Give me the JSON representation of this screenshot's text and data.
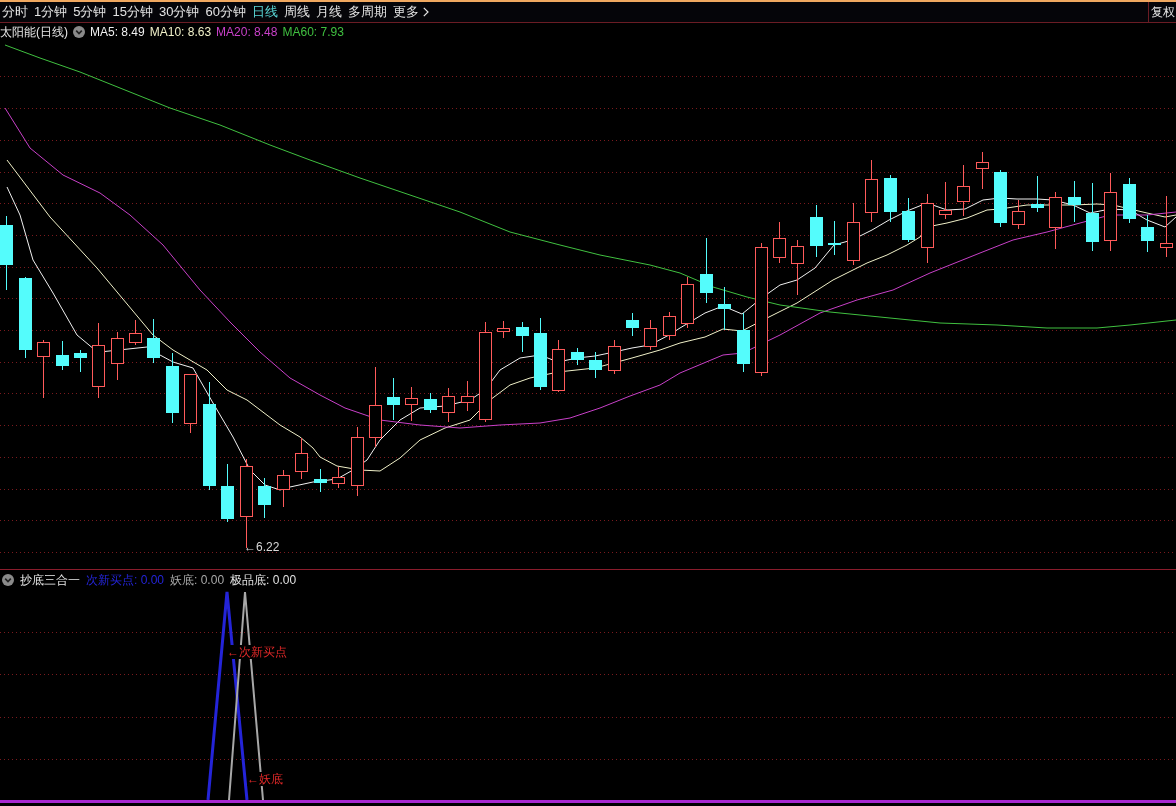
{
  "toolbar": {
    "tabs": [
      {
        "label": "分时",
        "selected": false,
        "kind": "period"
      },
      {
        "label": "1分钟",
        "selected": false,
        "kind": "period"
      },
      {
        "label": "5分钟",
        "selected": false,
        "kind": "period"
      },
      {
        "label": "15分钟",
        "selected": false,
        "kind": "period"
      },
      {
        "label": "30分钟",
        "selected": false,
        "kind": "period"
      },
      {
        "label": "60分钟",
        "selected": false,
        "kind": "period"
      },
      {
        "label": "日线",
        "selected": true,
        "kind": "period"
      },
      {
        "label": "周线",
        "selected": false,
        "kind": "period"
      },
      {
        "label": "月线",
        "selected": false,
        "kind": "period"
      },
      {
        "label": "多周期",
        "selected": false,
        "kind": "period"
      },
      {
        "label": "更多",
        "selected": false,
        "kind": "menu"
      }
    ],
    "adjust_button": "复权"
  },
  "price_chart": {
    "title": "太阳能(日线)",
    "moving_averages": [
      {
        "label": "MA5: 8.49",
        "color": "#f0f0f0"
      },
      {
        "label": "MA10: 8.63",
        "color": "#f0f0c8"
      },
      {
        "label": "MA20: 8.48",
        "color": "#c840c8"
      },
      {
        "label": "MA60: 7.93",
        "color": "#40c040"
      }
    ],
    "low_marker": "←6.22"
  },
  "indicator": {
    "title": "抄底三合一",
    "signals": [
      {
        "label": "次新买点: 0.00",
        "color": "#2424d8"
      },
      {
        "label": "妖底: 0.00",
        "color": "#a8a8a8"
      },
      {
        "label": "极品底: 0.00",
        "color": "#e0e0e0"
      }
    ],
    "annotations": [
      "←次新买点",
      "←妖底"
    ]
  }
}
